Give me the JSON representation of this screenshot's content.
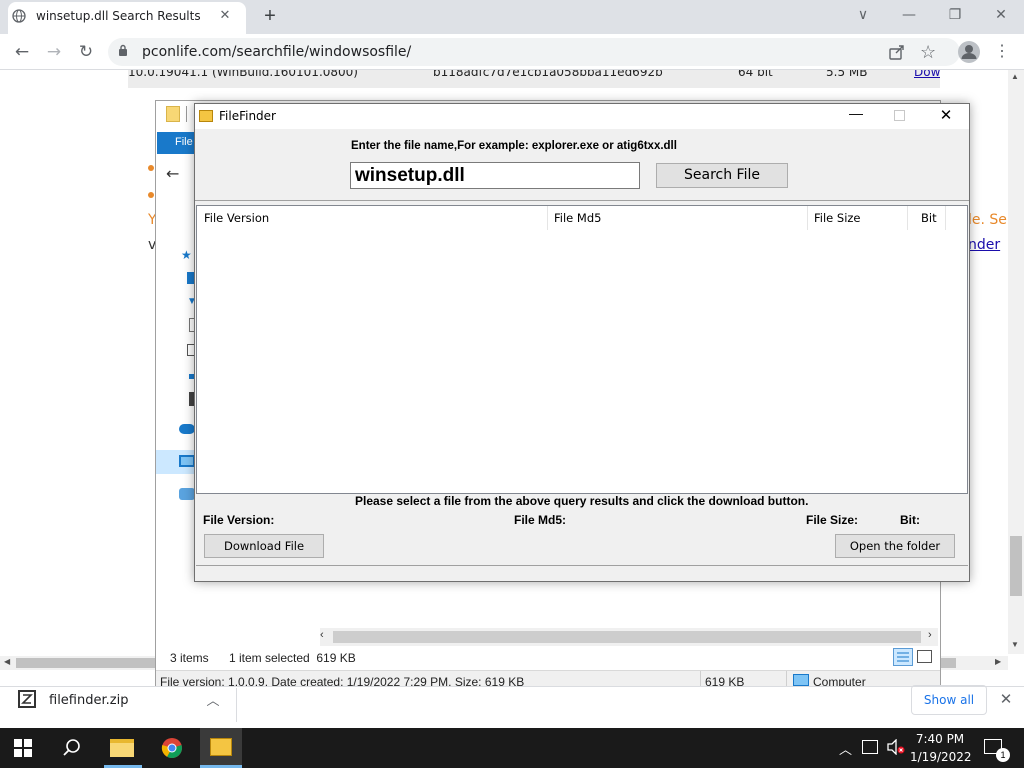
{
  "browser": {
    "tab_title": "winsetup.dll Search Results",
    "new_tab": "+",
    "url": "pconlife.com/searchfile/windowsosfile/",
    "window_controls": [
      "∨",
      "—",
      "❐",
      "✕"
    ]
  },
  "webpage": {
    "row": {
      "version": "10.0.19041.1 (WinBuild.160101.0800)",
      "md5": "b118adfc7d7e1cb1a058bba11ed692b",
      "bit": "64 bit",
      "size": "5.5 MB",
      "download": "Download"
    },
    "fragment_orange": "le. Se",
    "fragment_link": "nder",
    "left_y": "Y",
    "left_v": "v"
  },
  "explorer": {
    "file_tab": "File",
    "items_count": "3 items",
    "selected": "1 item selected  619 KB",
    "info_text": "File version: 1.0.0.9, Date created: 1/19/2022 7:29 PM, Size: 619 KB",
    "info_size": "619 KB",
    "info_location": "Computer"
  },
  "filefinder": {
    "title": "FileFinder",
    "prompt": "Enter the file name,For example: explorer.exe or atig6txx.dll",
    "search_value": "winsetup.dll",
    "search_button": "Search File",
    "columns": [
      "File Version",
      "File Md5",
      "File Size",
      "Bit"
    ],
    "instruction": "Please select a file from the above query results and click the download button.",
    "file_version_label": "File Version:",
    "file_md5_label": "File Md5:",
    "file_size_label": "File Size:",
    "bit_label": "Bit:",
    "download_button": "Download File",
    "open_folder_button": "Open the folder"
  },
  "shelf": {
    "file_name": "filefinder.zip",
    "show_all": "Show all"
  },
  "taskbar": {
    "time": "7:40 PM",
    "date": "1/19/2022",
    "notification_count": "1"
  },
  "colors": {
    "accent_blue": "#1979ca",
    "chrome_tabstrip": "#dee1e6",
    "taskbar": "#1a1a1a",
    "page_orange": "#e8892b",
    "link_blue": "#1a0dab"
  }
}
